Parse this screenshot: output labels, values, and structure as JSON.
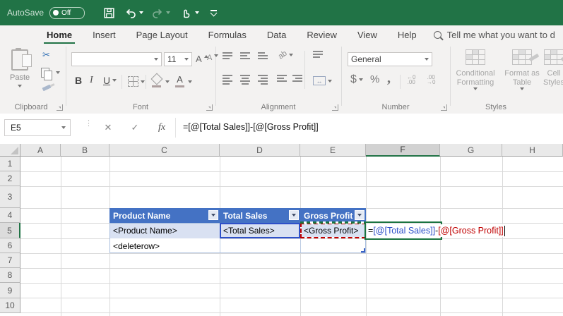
{
  "titlebar": {
    "autosave_label": "AutoSave",
    "autosave_state": "Off"
  },
  "tabs": {
    "items": [
      "Home",
      "Insert",
      "Page Layout",
      "Formulas",
      "Data",
      "Review",
      "View",
      "Help"
    ],
    "active": "Home",
    "tellme": "Tell me what you want to d"
  },
  "ribbon": {
    "clipboard": {
      "label": "Clipboard",
      "paste": "Paste"
    },
    "font": {
      "label": "Font",
      "size": "11",
      "bold": "B",
      "italic": "I",
      "underline": "U",
      "color_letter": "A",
      "grow_letter": "A",
      "shrink_letter": "A"
    },
    "alignment": {
      "label": "Alignment",
      "orientation_glyph": "ab",
      "merge_glyph": "↔"
    },
    "number": {
      "label": "Number",
      "format": "General",
      "currency": "$",
      "percent": "%",
      "comma": ",",
      "inc_dec_top": "←0",
      "inc_dec_bottom": ".00",
      "dec_dec_top": ".00",
      "dec_dec_bottom": "→0"
    },
    "styles": {
      "label": "Styles",
      "conditional": "Conditional Formatting",
      "format_table": "Format as Table",
      "cell_styles": "Cell Styles"
    }
  },
  "icons": {
    "cut": "✂",
    "cancel": "✕",
    "enter": "✓",
    "insert_function": "fx",
    "dots": "⋮"
  },
  "formula_bar": {
    "name_box": "E5",
    "formula": "=[@[Total Sales]]-[@[Gross Profit]]"
  },
  "cell_formula": {
    "eq": "=",
    "ref1": "[@[Total Sales]]",
    "op": "-",
    "ref2": "[@[Gross Profit]]"
  },
  "grid": {
    "columns": [
      "A",
      "B",
      "C",
      "D",
      "E",
      "F",
      "G",
      "H"
    ],
    "rows": [
      "1",
      "2",
      "3",
      "4",
      "5",
      "6",
      "7",
      "8",
      "9",
      "10"
    ],
    "active_cell": "E5",
    "selected_column": "F",
    "selected_row": "5"
  },
  "table": {
    "headers": [
      "Product Name",
      "Total Sales",
      "Gross Profit"
    ],
    "row5": [
      "<Product Name>",
      "<Total Sales>",
      "<Gross Profit>"
    ],
    "row6": [
      "<deleterow>"
    ]
  },
  "colors": {
    "excel_green": "#217346",
    "table_header_blue": "#4472C4",
    "banded_row_blue": "#D9E1F2",
    "ref_blue": "#2E50C8",
    "ref_red": "#C00000"
  }
}
